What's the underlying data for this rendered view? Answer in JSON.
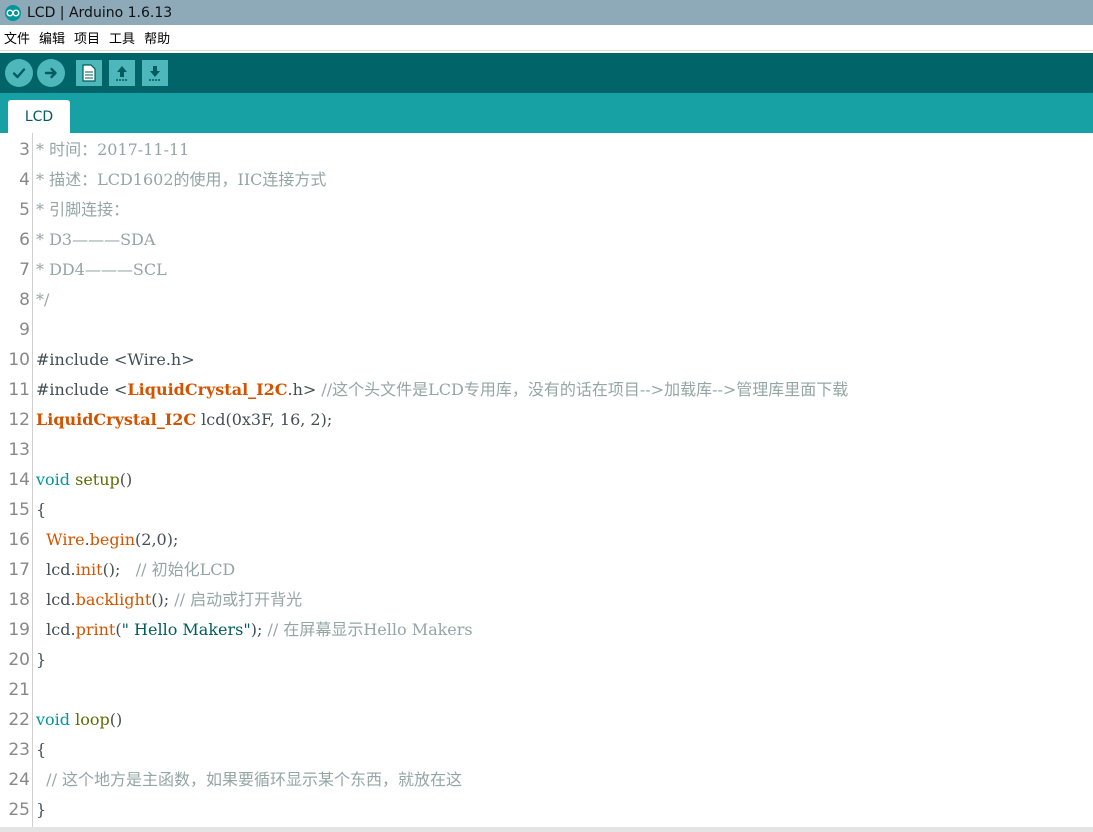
{
  "window": {
    "title": "LCD | Arduino 1.6.13",
    "logo_icon": "arduino-infinity-icon"
  },
  "menu": {
    "items": [
      "文件",
      "编辑",
      "项目",
      "工具",
      "帮助"
    ]
  },
  "toolbar": {
    "buttons": [
      {
        "name": "verify",
        "icon": "checkmark-icon"
      },
      {
        "name": "upload",
        "icon": "arrow-right-icon"
      },
      {
        "name": "new",
        "icon": "new-sketch-icon"
      },
      {
        "name": "open",
        "icon": "arrow-up-icon"
      },
      {
        "name": "save",
        "icon": "arrow-down-icon"
      }
    ]
  },
  "tabs": [
    {
      "label": "LCD",
      "active": true
    }
  ],
  "editor": {
    "line_numbers": [
      "3",
      "4",
      "5",
      "6",
      "7",
      "8",
      "9",
      "10",
      "11",
      "12",
      "13",
      "14",
      "15",
      "16",
      "17",
      "18",
      "19",
      "20",
      "21",
      "22",
      "23",
      "24",
      "25"
    ],
    "code": {
      "l3": "* 时间：2017-11-11",
      "l4": "* 描述：LCD1602的使用，IIC连接方式",
      "l5": "* 引脚连接：",
      "l6": "* D3———SDA",
      "l7": "* DD4———SCL",
      "l8": "*/",
      "l10": {
        "directive": "#include",
        "header": "<Wire.h>"
      },
      "l11": {
        "directive": "#include",
        "lt": "<",
        "lib": "LiquidCrystal_I2C",
        "rest": ".h>",
        "comment": " //这个头文件是LCD专用库，没有的话在项目-->加载库-->管理库里面下载"
      },
      "l12": {
        "type": "LiquidCrystal_I2C",
        "rest": " lcd(0x3F, 16, 2);"
      },
      "l14": {
        "keyword": "void",
        "func": "setup",
        "paren": "()"
      },
      "l15": "{",
      "l16": {
        "obj": "Wire",
        "dot": ".",
        "method": "begin",
        "args": "(2,0);"
      },
      "l17": {
        "obj": "lcd",
        "dot": ".",
        "method": "init",
        "args": "();",
        "comment": "   // 初始化LCD"
      },
      "l18": {
        "obj": "lcd",
        "dot": ".",
        "method": "backlight",
        "args": "();",
        "comment": " // 启动或打开背光"
      },
      "l19": {
        "obj": "lcd",
        "dot": ".",
        "method": "print",
        "open": "(",
        "string": "\" Hello Makers\"",
        "close": ");",
        "comment": " // 在屏幕显示Hello Makers"
      },
      "l20": "}",
      "l22": {
        "keyword": "void",
        "func": "loop",
        "paren": "()"
      },
      "l23": "{",
      "l24": "  // 这个地方是主函数，如果要循环显示某个东西，就放在这",
      "l25": "}"
    }
  }
}
